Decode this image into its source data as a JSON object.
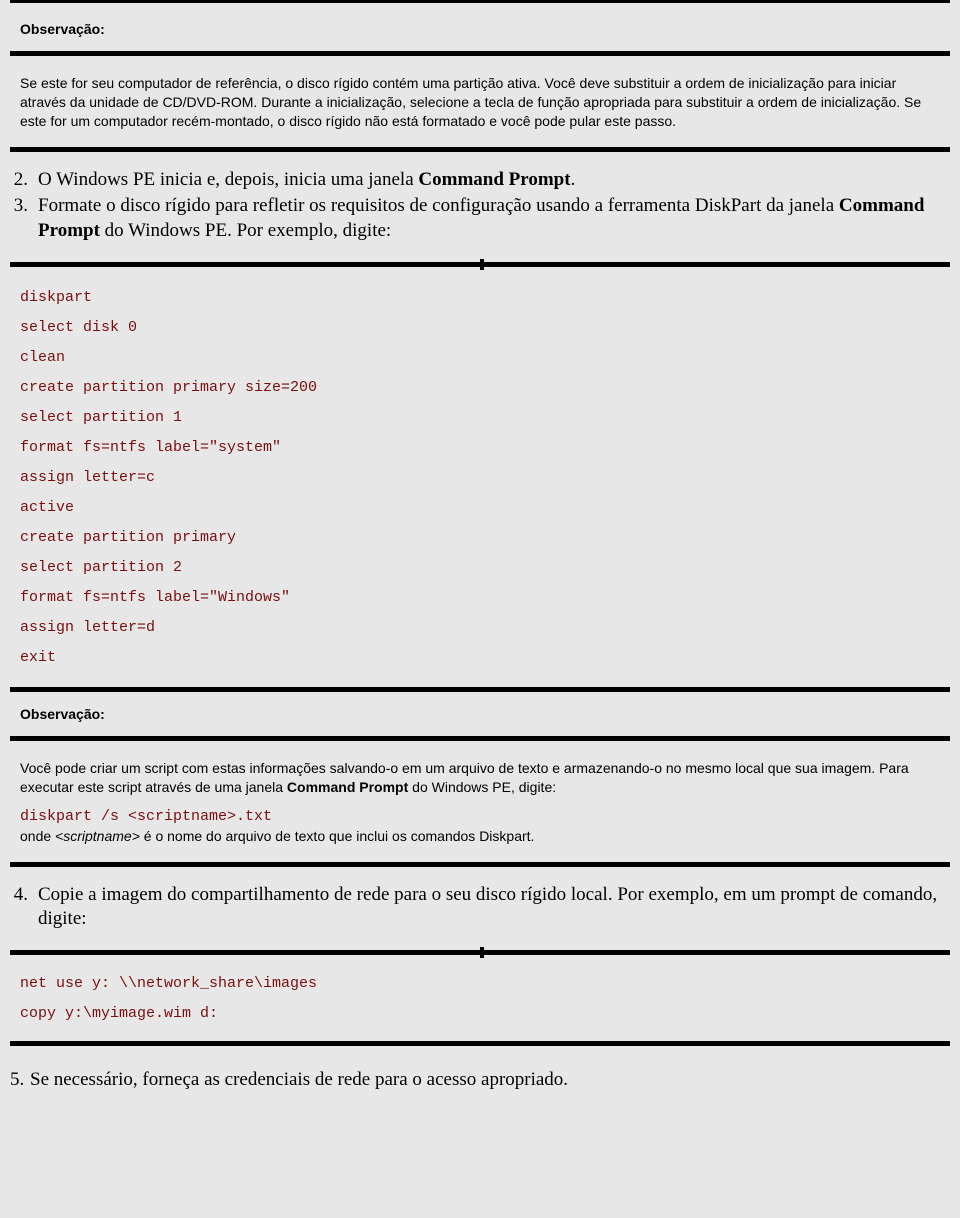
{
  "obs1": {
    "header": "Observação:",
    "body": "Se este for seu computador de referência, o disco rígido contém uma partição ativa. Você deve substituir a ordem de inicialização para iniciar através da unidade de CD/DVD-ROM. Durante a inicialização, selecione a tecla de função apropriada para substituir a ordem de inicialização. Se este for um computador recém-montado, o disco rígido não está formatado e você pode pular este passo."
  },
  "step2": {
    "num": "2.",
    "pre": "O Windows PE inicia e, depois, inicia uma janela ",
    "bold": "Command Prompt",
    "post": "."
  },
  "step3": {
    "num": "3.",
    "pre": "Formate o disco rígido para refletir os requisitos de configuração usando a ferramenta DiskPart da janela ",
    "bold": "Command Prompt",
    "post": "  do Windows PE. Por exemplo, digite:"
  },
  "code1": [
    "diskpart",
    "select disk 0",
    "clean",
    "create partition primary size=200",
    "select partition 1",
    "format fs=ntfs label=\"system\"",
    "assign letter=c",
    "active",
    "create partition primary",
    "select partition 2",
    "format fs=ntfs label=\"Windows\"",
    "assign letter=d",
    "exit"
  ],
  "obs2": {
    "header": "Observação:",
    "p1_pre": "Você pode criar um script com estas informações salvando-o em um arquivo de texto e armazenando-o no mesmo local que sua imagem. Para executar este script através de uma janela ",
    "p1_bold": "Command Prompt",
    "p1_post": " do Windows PE, digite:",
    "code": "diskpart /s <scriptname>.txt",
    "p2_pre": "onde ",
    "p2_it": "<scriptname>",
    "p2_post": " é o nome do arquivo de texto que inclui os comandos Diskpart."
  },
  "step4": {
    "num": "4.",
    "text": "Copie a imagem do compartilhamento de rede para o seu disco rígido local. Por exemplo, em um prompt de comando, digite:"
  },
  "code2": [
    "net use y: \\\\network_share\\images",
    "copy y:\\myimage.wim d:"
  ],
  "step5": {
    "num": "5.",
    "text": "Se necessário, forneça as credenciais de rede para o acesso apropriado."
  }
}
